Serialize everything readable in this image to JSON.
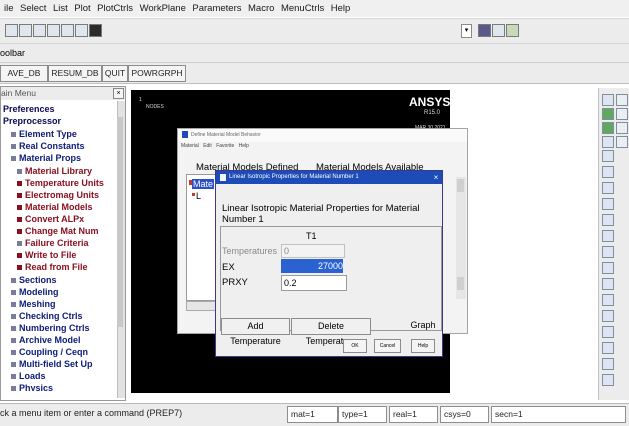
{
  "menubar": {
    "items": [
      "ile",
      "Select",
      "List",
      "Plot",
      "PlotCtrls",
      "WorkPlane",
      "Parameters",
      "Macro",
      "MenuCtrls",
      "Help"
    ]
  },
  "toolbar": {
    "label": "oolbar",
    "buttons": [
      "AVE_DB",
      "RESUM_DB",
      "QUIT",
      "POWRGRPH"
    ]
  },
  "main_menu": {
    "title": "ain Menu",
    "items": [
      {
        "label": "Preferences",
        "level": "top"
      },
      {
        "label": "Preprocessor",
        "level": "top"
      },
      {
        "label": "Element Type",
        "level": "sub"
      },
      {
        "label": "Real Constants",
        "level": "sub"
      },
      {
        "label": "Material Props",
        "level": "sub"
      },
      {
        "label": "Material Library",
        "level": "mat"
      },
      {
        "label": "Temperature Units",
        "level": "mat"
      },
      {
        "label": "Electromag Units",
        "level": "mat"
      },
      {
        "label": "Material Models",
        "level": "mat",
        "selected": true
      },
      {
        "label": "Convert ALPx",
        "level": "mat"
      },
      {
        "label": "Change Mat Num",
        "level": "mat"
      },
      {
        "label": "Failure Criteria",
        "level": "mat"
      },
      {
        "label": "Write to File",
        "level": "mat"
      },
      {
        "label": "Read from File",
        "level": "mat"
      },
      {
        "label": "Sections",
        "level": "sub"
      },
      {
        "label": "Modeling",
        "level": "sub"
      },
      {
        "label": "Meshing",
        "level": "sub"
      },
      {
        "label": "Checking Ctrls",
        "level": "sub"
      },
      {
        "label": "Numbering Ctrls",
        "level": "sub"
      },
      {
        "label": "Archive Model",
        "level": "sub"
      },
      {
        "label": "Coupling / Ceqn",
        "level": "sub"
      },
      {
        "label": "Multi-field Set Up",
        "level": "sub"
      },
      {
        "label": "Loads",
        "level": "sub"
      },
      {
        "label": "Physics",
        "level": "sub"
      }
    ]
  },
  "graphics": {
    "window_number": "1",
    "nodes_label": "NODES",
    "logo": "ANSYS",
    "version": "R15.0",
    "date": "MAR 30 2021"
  },
  "define_dialog": {
    "title": "Define Material Model Behavior",
    "menu": [
      "Material",
      "Edit",
      "Favorite",
      "Help"
    ],
    "defined_heading": "Material Models Defined",
    "available_heading": "Material Models Available",
    "tree_item": "Mate",
    "tree_sub": "L"
  },
  "linear_dialog": {
    "title": "Linear Isotropic Properties for Material Number 1",
    "heading": "Linear Isotropic Material Properties for Material Number 1",
    "column": "T1",
    "temperatures_label": "Temperatures",
    "temperatures_value": "0",
    "ex_label": "EX",
    "ex_value": "27000",
    "prxy_label": "PRXY",
    "prxy_value": "0.2",
    "buttons": {
      "add_temperature": "Add Temperature",
      "delete_temperature": "Delete Temperature",
      "graph": "Graph",
      "ok": "OK",
      "cancel": "Cancel",
      "help": "Help"
    }
  },
  "status": {
    "prompt": "ck a menu item or enter a command (PREP7)",
    "fields": [
      "mat=1",
      "type=1",
      "real=1",
      "csys=0",
      "secn=1"
    ]
  },
  "colors": {
    "selection": "#2a4fc7",
    "dialog_title": "#1d4cb8",
    "graphics_bg": "#000000",
    "menu_top": "#0a0a5a",
    "menu_material": "#8a1020"
  }
}
